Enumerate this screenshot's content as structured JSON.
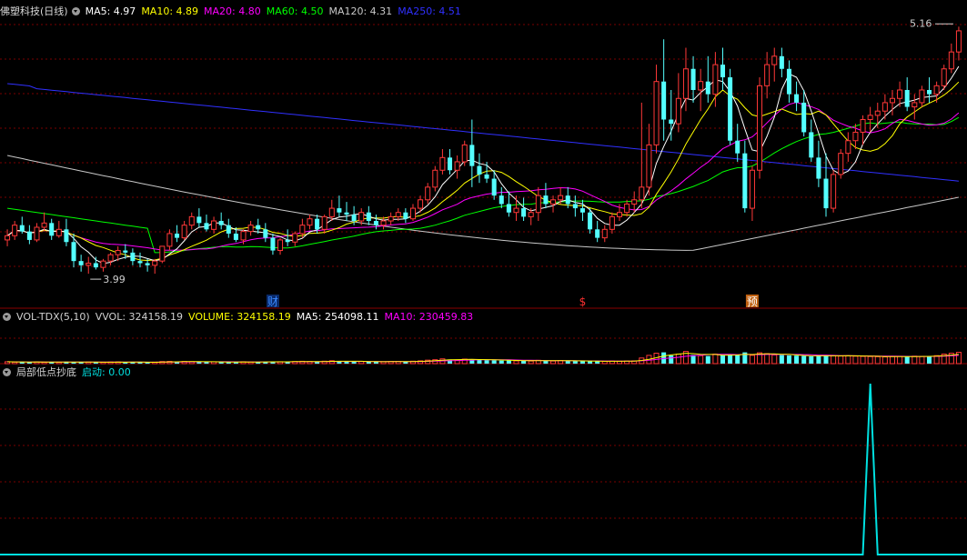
{
  "main": {
    "title": "佛塑科技(日线)",
    "ma": [
      {
        "label": "MA5: 4.97",
        "color": "#ffffff"
      },
      {
        "label": "MA10: 4.89",
        "color": "#ffff00"
      },
      {
        "label": "MA20: 4.80",
        "color": "#ff00ff"
      },
      {
        "label": "MA60: 4.50",
        "color": "#00ff00"
      },
      {
        "label": "MA120: 4.31",
        "color": "#c8c8c8"
      },
      {
        "label": "MA250: 4.51",
        "color": "#3030ff"
      }
    ],
    "high_label": "5.16",
    "low_label": "3.99",
    "markers": [
      {
        "text": "财",
        "color": "#3a8aff",
        "bg": "#0a2a6a",
        "day": 36
      },
      {
        "text": "$",
        "color": "#ff3030",
        "bg": "",
        "day": 78
      },
      {
        "text": "预",
        "color": "#ffffff",
        "bg": "#c06010",
        "day": 101
      }
    ]
  },
  "vol": {
    "title": "VOL-TDX(5,10)",
    "items": [
      {
        "label": "VVOL: 324158.19",
        "color": "#d0d0d0"
      },
      {
        "label": "VOLUME: 324158.19",
        "color": "#ffff00"
      },
      {
        "label": "MA5: 254098.11",
        "color": "#ffffff"
      },
      {
        "label": "MA10: 230459.83",
        "color": "#ff00ff"
      }
    ]
  },
  "ind": {
    "title": "局部低点抄底",
    "items": [
      {
        "label": "启动: 0.00",
        "color": "#00e0e0"
      }
    ]
  },
  "colors": {
    "up": "#ff3838",
    "down": "#54ffff",
    "grid": "#7a0000",
    "ma250": "#3030ff",
    "ma120": "#c8c8c8",
    "ma60": "#00ff00",
    "ma20": "#ff00ff",
    "ma10": "#ffff00",
    "ma5": "#ffffff",
    "signal": "#00e0e0"
  },
  "chart_data": {
    "type": "candlestick",
    "price_range": [
      3.9,
      5.2
    ],
    "volume_range": [
      0,
      440000
    ],
    "indicator_range": [
      0,
      1
    ],
    "days": 130,
    "signal_spike_day": 117,
    "ohlc": [
      [
        4.15,
        4.2,
        4.12,
        4.17
      ],
      [
        4.17,
        4.24,
        4.15,
        4.22
      ],
      [
        4.22,
        4.26,
        4.18,
        4.19
      ],
      [
        4.19,
        4.22,
        4.13,
        4.15
      ],
      [
        4.15,
        4.23,
        4.14,
        4.21
      ],
      [
        4.21,
        4.28,
        4.19,
        4.23
      ],
      [
        4.23,
        4.25,
        4.15,
        4.17
      ],
      [
        4.17,
        4.24,
        4.16,
        4.2
      ],
      [
        4.2,
        4.25,
        4.12,
        4.14
      ],
      [
        4.14,
        4.18,
        4.02,
        4.05
      ],
      [
        4.05,
        4.08,
        4.0,
        4.03
      ],
      [
        4.03,
        4.07,
        3.99,
        4.04
      ],
      [
        4.04,
        4.07,
        4.01,
        4.02
      ],
      [
        4.02,
        4.06,
        4.0,
        4.05
      ],
      [
        4.05,
        4.09,
        4.03,
        4.08
      ],
      [
        4.08,
        4.12,
        4.05,
        4.1
      ],
      [
        4.1,
        4.13,
        4.06,
        4.09
      ],
      [
        4.09,
        4.11,
        4.03,
        4.05
      ],
      [
        4.05,
        4.09,
        4.02,
        4.04
      ],
      [
        4.04,
        4.06,
        4.0,
        4.03
      ],
      [
        4.03,
        4.06,
        3.99,
        4.05
      ],
      [
        4.05,
        4.12,
        4.04,
        4.12
      ],
      [
        4.12,
        4.2,
        4.1,
        4.18
      ],
      [
        4.18,
        4.22,
        4.14,
        4.16
      ],
      [
        4.16,
        4.24,
        4.15,
        4.22
      ],
      [
        4.22,
        4.28,
        4.2,
        4.26
      ],
      [
        4.26,
        4.3,
        4.21,
        4.23
      ],
      [
        4.23,
        4.27,
        4.19,
        4.2
      ],
      [
        4.2,
        4.26,
        4.18,
        4.24
      ],
      [
        4.24,
        4.28,
        4.2,
        4.22
      ],
      [
        4.22,
        4.25,
        4.16,
        4.18
      ],
      [
        4.18,
        4.21,
        4.14,
        4.15
      ],
      [
        4.15,
        4.2,
        4.13,
        4.19
      ],
      [
        4.19,
        4.24,
        4.17,
        4.22
      ],
      [
        4.22,
        4.25,
        4.18,
        4.2
      ],
      [
        4.2,
        4.23,
        4.14,
        4.16
      ],
      [
        4.16,
        4.18,
        4.08,
        4.1
      ],
      [
        4.1,
        4.16,
        4.08,
        4.15
      ],
      [
        4.15,
        4.2,
        4.12,
        4.14
      ],
      [
        4.14,
        4.19,
        4.12,
        4.18
      ],
      [
        4.18,
        4.25,
        4.16,
        4.22
      ],
      [
        4.22,
        4.27,
        4.2,
        4.25
      ],
      [
        4.25,
        4.27,
        4.18,
        4.2
      ],
      [
        4.2,
        4.27,
        4.18,
        4.26
      ],
      [
        4.26,
        4.34,
        4.24,
        4.3
      ],
      [
        4.3,
        4.36,
        4.26,
        4.28
      ],
      [
        4.28,
        4.33,
        4.24,
        4.27
      ],
      [
        4.27,
        4.31,
        4.22,
        4.24
      ],
      [
        4.24,
        4.3,
        4.22,
        4.28
      ],
      [
        4.28,
        4.31,
        4.22,
        4.24
      ],
      [
        4.24,
        4.27,
        4.2,
        4.22
      ],
      [
        4.22,
        4.26,
        4.2,
        4.24
      ],
      [
        4.24,
        4.28,
        4.22,
        4.26
      ],
      [
        4.26,
        4.3,
        4.24,
        4.28
      ],
      [
        4.28,
        4.3,
        4.23,
        4.25
      ],
      [
        4.25,
        4.32,
        4.24,
        4.3
      ],
      [
        4.3,
        4.36,
        4.28,
        4.34
      ],
      [
        4.34,
        4.42,
        4.32,
        4.4
      ],
      [
        4.4,
        4.5,
        4.38,
        4.48
      ],
      [
        4.48,
        4.58,
        4.46,
        4.54
      ],
      [
        4.54,
        4.58,
        4.46,
        4.48
      ],
      [
        4.48,
        4.55,
        4.44,
        4.52
      ],
      [
        4.52,
        4.62,
        4.5,
        4.6
      ],
      [
        4.6,
        4.72,
        4.4,
        4.5
      ],
      [
        4.5,
        4.56,
        4.42,
        4.46
      ],
      [
        4.46,
        4.52,
        4.42,
        4.44
      ],
      [
        4.44,
        4.48,
        4.34,
        4.36
      ],
      [
        4.36,
        4.4,
        4.3,
        4.32
      ],
      [
        4.32,
        4.38,
        4.26,
        4.28
      ],
      [
        4.28,
        4.36,
        4.24,
        4.3
      ],
      [
        4.3,
        4.35,
        4.24,
        4.26
      ],
      [
        4.26,
        4.3,
        4.22,
        4.28
      ],
      [
        4.28,
        4.4,
        4.24,
        4.36
      ],
      [
        4.36,
        4.42,
        4.3,
        4.32
      ],
      [
        4.32,
        4.36,
        4.28,
        4.34
      ],
      [
        4.34,
        4.4,
        4.32,
        4.36
      ],
      [
        4.36,
        4.4,
        4.3,
        4.32
      ],
      [
        4.32,
        4.36,
        4.26,
        4.3
      ],
      [
        4.3,
        4.34,
        4.24,
        4.28
      ],
      [
        4.28,
        4.3,
        4.18,
        4.2
      ],
      [
        4.2,
        4.24,
        4.14,
        4.16
      ],
      [
        4.16,
        4.22,
        4.14,
        4.2
      ],
      [
        4.2,
        4.28,
        4.18,
        4.26
      ],
      [
        4.26,
        4.32,
        4.24,
        4.28
      ],
      [
        4.28,
        4.34,
        4.26,
        4.32
      ],
      [
        4.32,
        4.38,
        4.28,
        4.34
      ],
      [
        4.34,
        4.8,
        4.3,
        4.4
      ],
      [
        4.4,
        4.7,
        4.36,
        4.6
      ],
      [
        4.6,
        4.98,
        4.56,
        4.9
      ],
      [
        4.9,
        5.1,
        4.62,
        4.72
      ],
      [
        4.72,
        4.86,
        4.62,
        4.7
      ],
      [
        4.7,
        4.94,
        4.66,
        4.82
      ],
      [
        4.82,
        5.06,
        4.76,
        4.96
      ],
      [
        4.96,
        5.02,
        4.8,
        4.86
      ],
      [
        4.86,
        4.96,
        4.76,
        4.9
      ],
      [
        4.9,
        5.02,
        4.8,
        4.84
      ],
      [
        4.84,
        5.04,
        4.78,
        4.98
      ],
      [
        4.98,
        5.06,
        4.86,
        4.92
      ],
      [
        4.92,
        4.96,
        4.6,
        4.62
      ],
      [
        4.62,
        4.7,
        4.52,
        4.56
      ],
      [
        4.56,
        4.62,
        4.28,
        4.3
      ],
      [
        4.3,
        4.5,
        4.24,
        4.48
      ],
      [
        4.48,
        4.92,
        4.44,
        4.88
      ],
      [
        4.88,
        5.04,
        4.82,
        4.98
      ],
      [
        4.98,
        5.06,
        4.9,
        5.02
      ],
      [
        5.02,
        5.06,
        4.92,
        4.96
      ],
      [
        4.96,
        5.0,
        4.8,
        4.84
      ],
      [
        4.84,
        4.9,
        4.76,
        4.8
      ],
      [
        4.8,
        4.86,
        4.64,
        4.66
      ],
      [
        4.66,
        4.72,
        4.52,
        4.54
      ],
      [
        4.54,
        4.62,
        4.4,
        4.44
      ],
      [
        4.44,
        4.56,
        4.26,
        4.3
      ],
      [
        4.3,
        4.48,
        4.28,
        4.46
      ],
      [
        4.46,
        4.58,
        4.44,
        4.56
      ],
      [
        4.56,
        4.66,
        4.52,
        4.62
      ],
      [
        4.62,
        4.7,
        4.58,
        4.66
      ],
      [
        4.66,
        4.74,
        4.6,
        4.72
      ],
      [
        4.72,
        4.78,
        4.66,
        4.74
      ],
      [
        4.74,
        4.8,
        4.68,
        4.76
      ],
      [
        4.76,
        4.84,
        4.72,
        4.8
      ],
      [
        4.8,
        4.86,
        4.74,
        4.82
      ],
      [
        4.82,
        4.9,
        4.78,
        4.86
      ],
      [
        4.86,
        4.92,
        4.76,
        4.78
      ],
      [
        4.78,
        4.84,
        4.72,
        4.8
      ],
      [
        4.8,
        4.88,
        4.78,
        4.86
      ],
      [
        4.86,
        4.92,
        4.8,
        4.84
      ],
      [
        4.84,
        4.9,
        4.8,
        4.88
      ],
      [
        4.88,
        4.98,
        4.86,
        4.96
      ],
      [
        4.96,
        5.08,
        4.94,
        5.04
      ],
      [
        5.04,
        5.16,
        5.0,
        5.14
      ]
    ],
    "volume": [
      22000,
      18000,
      20000,
      17000,
      21000,
      16000,
      19000,
      15000,
      23000,
      20000,
      17000,
      18000,
      15000,
      16000,
      19000,
      20000,
      14000,
      18000,
      16000,
      15000,
      17000,
      24000,
      26000,
      22000,
      25000,
      23000,
      20000,
      19000,
      21000,
      18000,
      17000,
      19000,
      22000,
      20000,
      18000,
      21000,
      26000,
      22000,
      20000,
      24000,
      27000,
      25000,
      19000,
      28000,
      33000,
      30000,
      24000,
      22000,
      26000,
      21000,
      20000,
      22000,
      24000,
      26000,
      21000,
      28000,
      32000,
      40000,
      45000,
      55000,
      48000,
      42000,
      52000,
      50000,
      44000,
      40000,
      38000,
      35000,
      36000,
      32000,
      34000,
      30000,
      38000,
      34000,
      30000,
      36000,
      32000,
      30000,
      28000,
      26000,
      28000,
      26000,
      30000,
      28000,
      30000,
      32000,
      65000,
      95000,
      120000,
      130000,
      95000,
      110000,
      140000,
      100000,
      92000,
      88000,
      110000,
      96000,
      105000,
      98000,
      130000,
      96000,
      125000,
      115000,
      100000,
      98000,
      95000,
      92000,
      88000,
      84000,
      90000,
      96000,
      92000,
      88000,
      90000,
      86000,
      84000,
      82000,
      80000,
      78000,
      82000,
      84000,
      80000,
      86000,
      82000,
      88000,
      92000,
      110000,
      120000,
      130000
    ]
  }
}
